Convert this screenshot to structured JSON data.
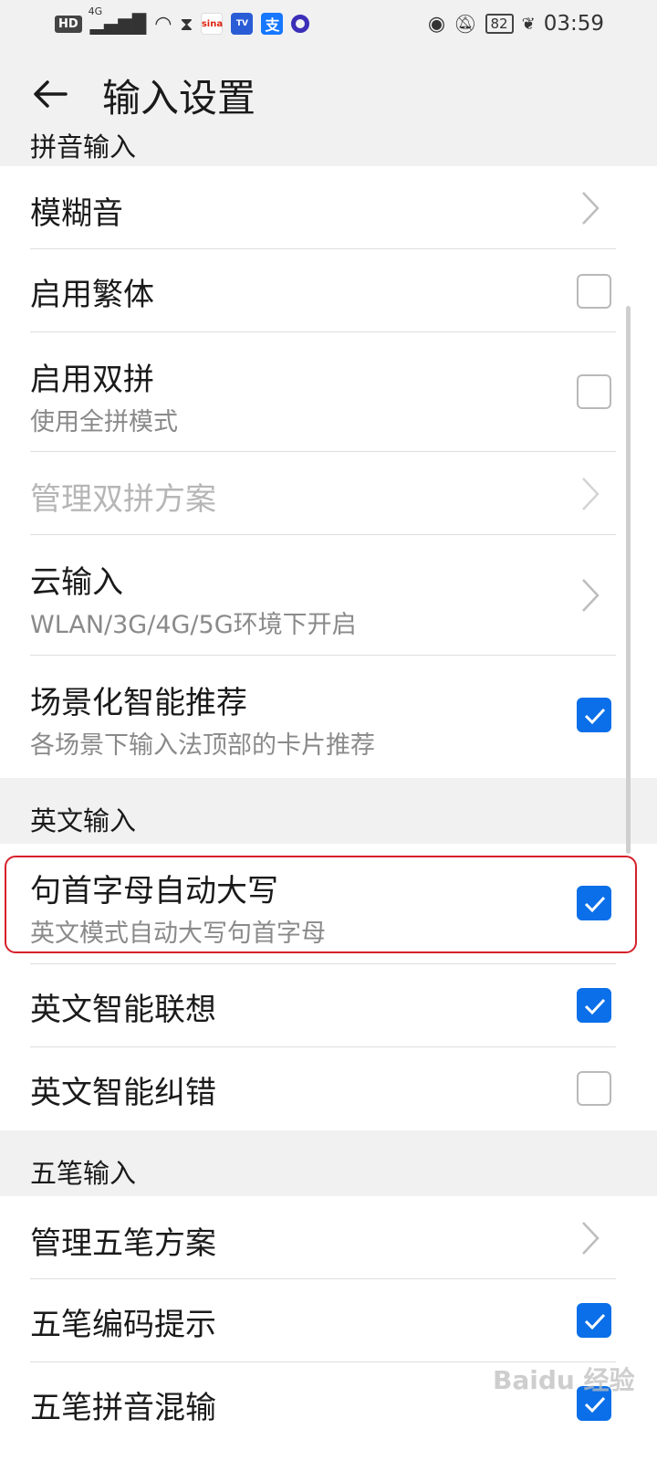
{
  "status_bar": {
    "left_badges": [
      "HD",
      "4G",
      "sina",
      "TV"
    ],
    "battery": "82",
    "time": "03:59"
  },
  "header": {
    "title": "输入设置"
  },
  "sections": {
    "pinyin": {
      "label": "拼音输入",
      "rows": [
        {
          "title": "模糊音",
          "control": "chevron"
        },
        {
          "title": "启用繁体",
          "control": "checkbox",
          "checked": false
        },
        {
          "title": "启用双拼",
          "subtitle": "使用全拼模式",
          "control": "checkbox",
          "checked": false
        },
        {
          "title": "管理双拼方案",
          "control": "chevron",
          "disabled": true
        },
        {
          "title": "云输入",
          "subtitle": "WLAN/3G/4G/5G环境下开启",
          "control": "chevron"
        },
        {
          "title": "场景化智能推荐",
          "subtitle": "各场景下输入法顶部的卡片推荐",
          "control": "checkbox",
          "checked": true
        }
      ]
    },
    "english": {
      "label": "英文输入",
      "rows": [
        {
          "title": "句首字母自动大写",
          "subtitle": "英文模式自动大写句首字母",
          "control": "checkbox",
          "checked": true
        },
        {
          "title": "英文智能联想",
          "control": "checkbox",
          "checked": true
        },
        {
          "title": "英文智能纠错",
          "control": "checkbox",
          "checked": false
        }
      ]
    },
    "wubi": {
      "label": "五笔输入",
      "rows": [
        {
          "title": "管理五笔方案",
          "control": "chevron"
        },
        {
          "title": "五笔编码提示",
          "control": "checkbox",
          "checked": true
        },
        {
          "title": "五笔拼音混输",
          "control": "checkbox",
          "checked": true
        }
      ]
    }
  },
  "watermark": "Baidu 经验",
  "colors": {
    "accent": "#0a6fe8",
    "highlight": "#d6202a"
  }
}
